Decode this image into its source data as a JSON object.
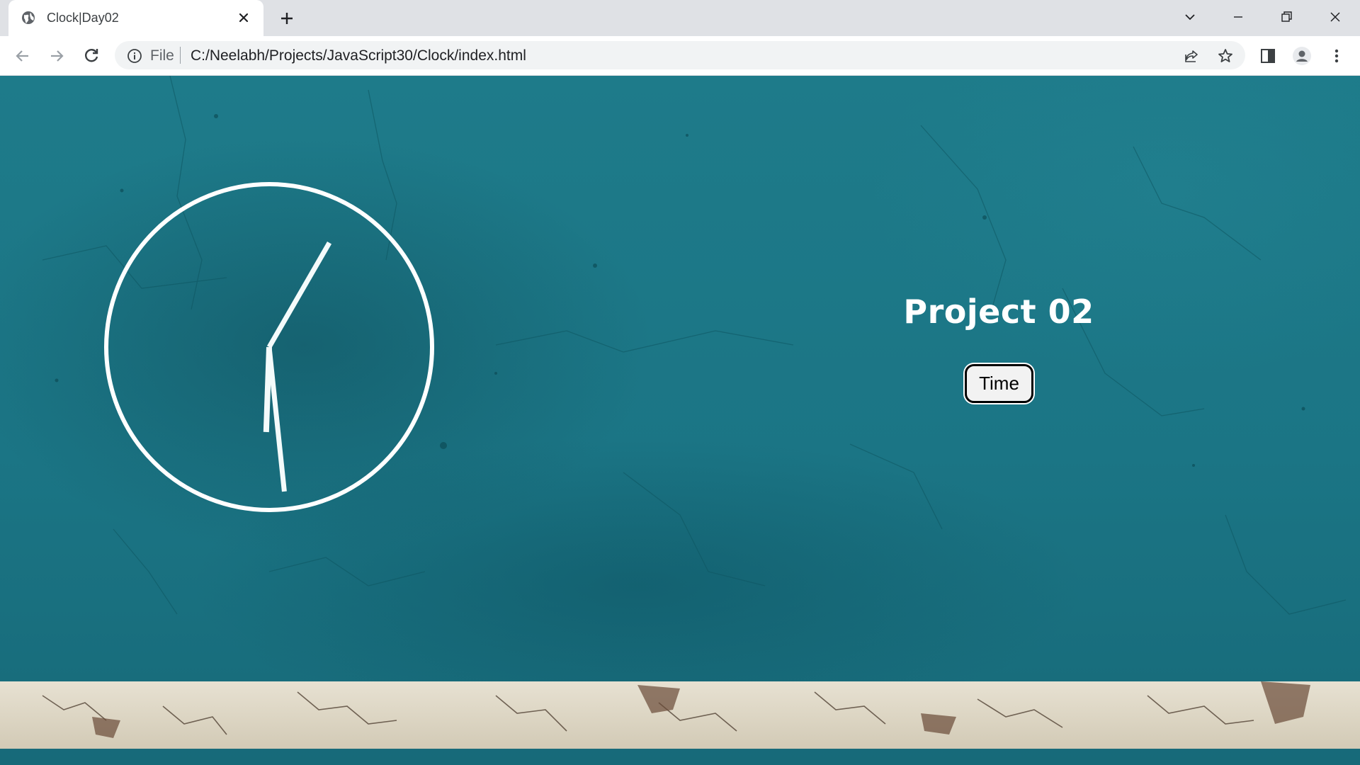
{
  "browser": {
    "tab_title": "Clock|Day02",
    "url_scheme": "File",
    "url": "C:/Neelabh/Projects/JavaScript30/Clock/index.html"
  },
  "page": {
    "title": "Project 02",
    "button_label": "Time",
    "clock": {
      "hour_hand_angle_deg": 182,
      "minute_hand_angle_deg": 174,
      "second_hand_angle_deg": 30,
      "color": "#ffffff"
    }
  },
  "colors": {
    "background": "#1b7585",
    "stripe": "#ddd6c4",
    "text": "#ffffff"
  }
}
